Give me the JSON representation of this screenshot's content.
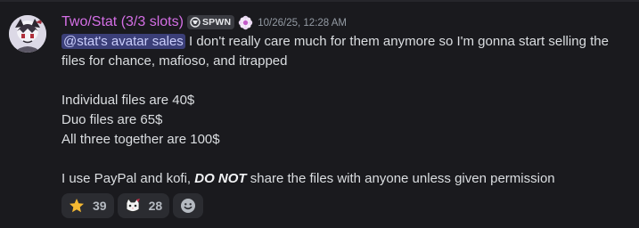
{
  "author": {
    "name": "Two/Stat (3/3 slots)",
    "name_color": "#d56fe6",
    "guild_tag": "SPWN",
    "timestamp": "10/26/25, 12:28 AM",
    "avatar_icon": "avatar-image",
    "role_icon": "flower-role-icon"
  },
  "message": {
    "mention": "@stat's avatar sales",
    "line1_rest": " I don't really care much for them anymore so I'm gonna start selling the",
    "line2": "files for chance, mafioso, and itrapped",
    "price_lines": [
      "Individual files are 40$",
      "Duo files are 65$",
      "All three together are 100$"
    ],
    "final_prefix": "I use PayPal and kofi, ",
    "final_emphasis": "DO NOT",
    "final_suffix": " share the files with anyone unless given permission"
  },
  "reactions": [
    {
      "emoji": "star",
      "count": "39"
    },
    {
      "emoji": "cat-face",
      "count": "28"
    }
  ],
  "add_reaction_icon": "smile-icon",
  "colors": {
    "background": "#1a1a1e",
    "mention_bg": "#3b3f78",
    "mention_text": "#c9cdfb",
    "reaction_bg": "#2b2c31"
  }
}
